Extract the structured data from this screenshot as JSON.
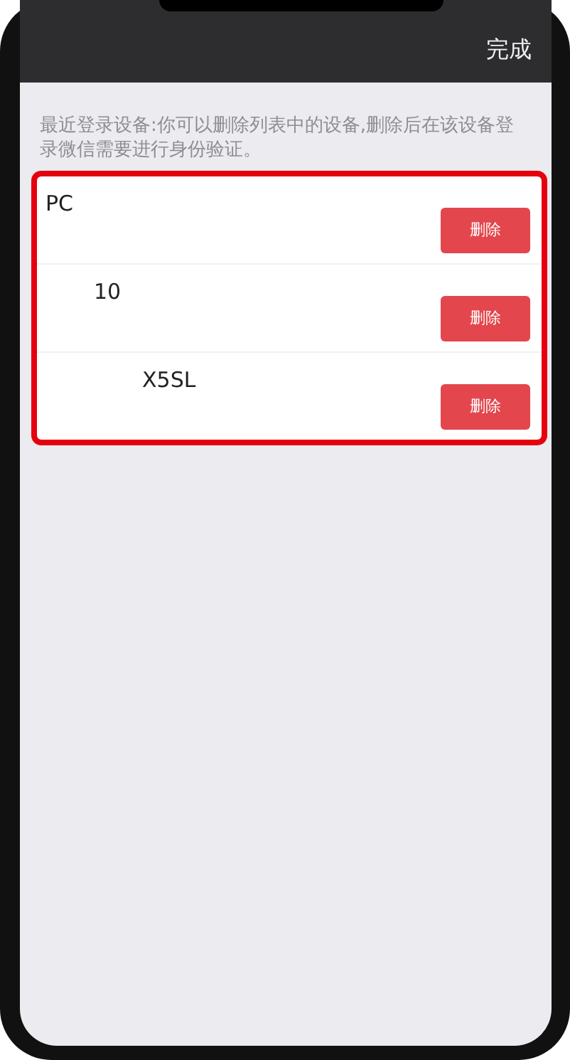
{
  "header": {
    "done": "完成"
  },
  "description": "最近登录设备:你可以删除列表中的设备,删除后在该设备登录微信需要进行身份验证。",
  "devices": [
    {
      "name": "PC",
      "button": "删除"
    },
    {
      "name": "10",
      "button": "删除"
    },
    {
      "name": "X5SL",
      "button": "删除"
    }
  ]
}
